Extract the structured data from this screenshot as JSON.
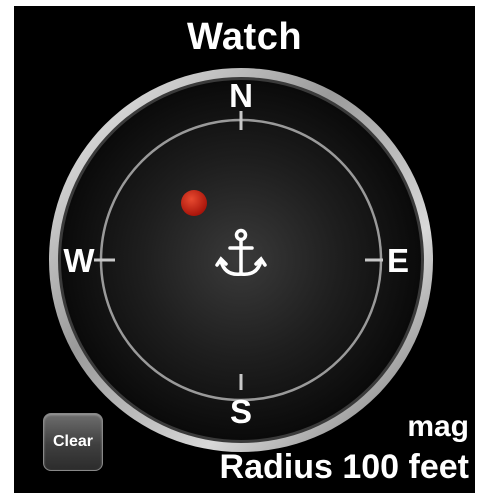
{
  "header": {
    "title": "Watch"
  },
  "compass": {
    "north": "N",
    "south": "S",
    "east": "E",
    "west": "W",
    "anchor_icon": "anchor-icon",
    "marker_color": "#c81e0e"
  },
  "controls": {
    "clear_label": "Clear"
  },
  "status": {
    "mode_label": "mag",
    "radius_label": "Radius 100 feet"
  }
}
